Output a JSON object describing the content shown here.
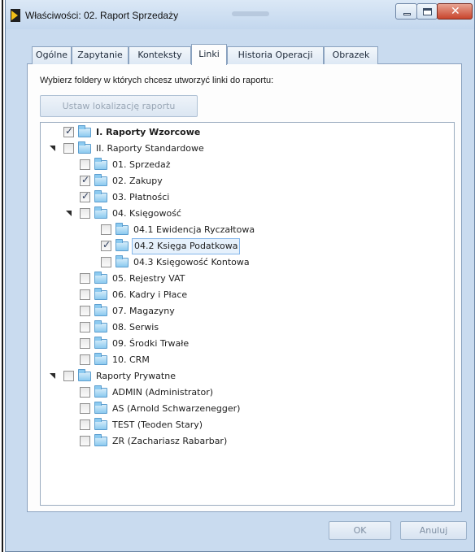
{
  "window": {
    "title": "Właściwości: 02. Raport Sprzedaży"
  },
  "tabs": [
    "Ogólne",
    "Zapytanie",
    "Konteksty",
    "Linki",
    "Historia Operacji",
    "Obrazek"
  ],
  "active_tab": "Linki",
  "instruction": "Wybierz foldery w których chcesz utworzyć linki do raportu:",
  "set_location_label": "Ustaw lokalizację raportu",
  "tree": [
    {
      "label": "I. Raporty Wzorcowe",
      "checked": true,
      "bold": true,
      "level": 0,
      "expanded": null
    },
    {
      "label": "II. Raporty Standardowe",
      "checked": false,
      "level": 0,
      "expanded": true
    },
    {
      "label": "01. Sprzedaż",
      "checked": false,
      "level": 1
    },
    {
      "label": "02. Zakupy",
      "checked": true,
      "level": 1
    },
    {
      "label": "03. Płatności",
      "checked": true,
      "level": 1
    },
    {
      "label": "04. Księgowość",
      "checked": false,
      "level": 1,
      "expanded": true
    },
    {
      "label": "04.1 Ewidencja Ryczałtowa",
      "checked": false,
      "level": 2
    },
    {
      "label": "04.2 Księga Podatkowa",
      "checked": true,
      "level": 2,
      "selected": true
    },
    {
      "label": "04.3 Księgowość Kontowa",
      "checked": false,
      "level": 2
    },
    {
      "label": "05. Rejestry VAT",
      "checked": false,
      "level": 1
    },
    {
      "label": "06. Kadry i Płace",
      "checked": false,
      "level": 1
    },
    {
      "label": "07. Magazyny",
      "checked": false,
      "level": 1
    },
    {
      "label": "08. Serwis",
      "checked": false,
      "level": 1
    },
    {
      "label": "09. Środki Trwałe",
      "checked": false,
      "level": 1
    },
    {
      "label": "10. CRM",
      "checked": false,
      "level": 1
    },
    {
      "label": "Raporty Prywatne",
      "checked": false,
      "level": 0,
      "expanded": true
    },
    {
      "label": "ADMIN (Administrator)",
      "checked": false,
      "level": 1
    },
    {
      "label": "AS (Arnold Schwarzenegger)",
      "checked": false,
      "level": 1
    },
    {
      "label": "TEST (Teoden Stary)",
      "checked": false,
      "level": 1
    },
    {
      "label": "ZR (Zachariasz Rabarbar)",
      "checked": false,
      "level": 1
    }
  ],
  "buttons": {
    "ok": "OK",
    "cancel": "Anuluj"
  },
  "colors": {
    "window_bg": "#c9dbef",
    "close_button": "#c9452d",
    "folder": "#8ccaf0",
    "selection": "#e6f1fc"
  }
}
